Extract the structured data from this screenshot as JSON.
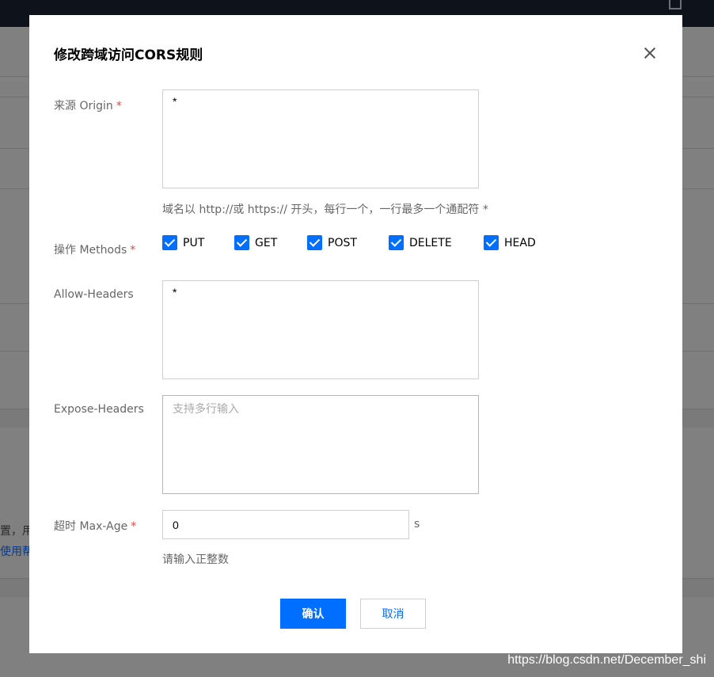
{
  "background": {
    "partial_text": "置，用",
    "partial_link": "使用帮"
  },
  "watermark": "https://blog.csdn.net/December_shi",
  "modal": {
    "title": "修改跨域访问CORS规则",
    "close_icon": "close-icon",
    "required_mark": "*",
    "origin": {
      "label": "来源 Origin",
      "value": "*",
      "help": "域名以 http://或 https:// 开头，每行一个，一行最多一个通配符 *"
    },
    "methods": {
      "label": "操作 Methods",
      "options": [
        {
          "label": "PUT",
          "checked": true
        },
        {
          "label": "GET",
          "checked": true
        },
        {
          "label": "POST",
          "checked": true
        },
        {
          "label": "DELETE",
          "checked": true
        },
        {
          "label": "HEAD",
          "checked": true
        }
      ]
    },
    "allow_headers": {
      "label": "Allow-Headers",
      "value": "*"
    },
    "expose_headers": {
      "label": "Expose-Headers",
      "value": "",
      "placeholder": "支持多行输入"
    },
    "max_age": {
      "label": "超时 Max-Age",
      "value": "0",
      "unit": "s",
      "help": "请输入正整数"
    },
    "confirm_label": "确认",
    "cancel_label": "取消"
  },
  "colors": {
    "accent": "#006eff",
    "required": "#e54545"
  }
}
